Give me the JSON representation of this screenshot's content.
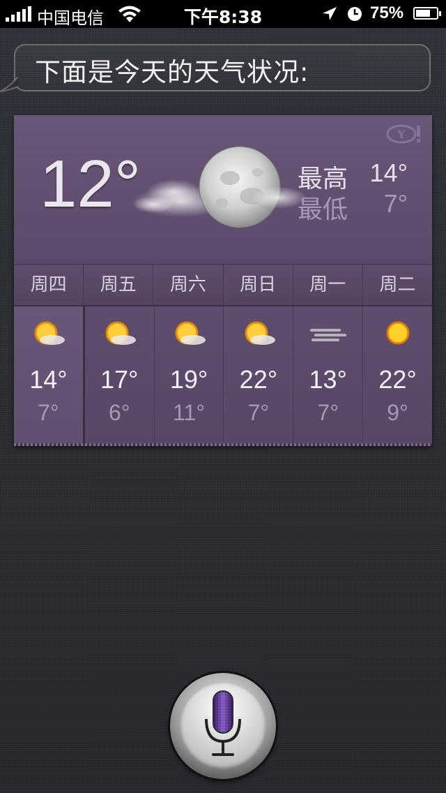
{
  "status_bar": {
    "carrier": "中国电信",
    "time": "下午8:38",
    "battery_percent": "75%",
    "battery_level": 0.75,
    "icons": [
      "signal-icon",
      "wifi-icon",
      "location-arrow-icon",
      "alarm-clock-icon",
      "battery-icon"
    ]
  },
  "siri": {
    "response": "下面是今天的天气状况:"
  },
  "weather": {
    "current_temp": "12°",
    "current_condition_icon": "moon-cloud-icon",
    "high_label": "最高",
    "high_value": "14°",
    "low_label": "最低",
    "low_value": "7°",
    "provider_icon": "yahoo-logo-icon",
    "forecast": [
      {
        "day": "周四",
        "icon": "sun-cloud-icon",
        "high": "14°",
        "low": "7°"
      },
      {
        "day": "周五",
        "icon": "sun-cloud-icon",
        "high": "17°",
        "low": "6°"
      },
      {
        "day": "周六",
        "icon": "sun-cloud-icon",
        "high": "19°",
        "low": "11°"
      },
      {
        "day": "周日",
        "icon": "sun-cloud-icon",
        "high": "22°",
        "low": "7°"
      },
      {
        "day": "周一",
        "icon": "wind-icon",
        "high": "13°",
        "low": "7°"
      },
      {
        "day": "周二",
        "icon": "sun-icon",
        "high": "22°",
        "low": "9°"
      }
    ]
  },
  "mic_button": {
    "icon": "microphone-icon"
  }
}
